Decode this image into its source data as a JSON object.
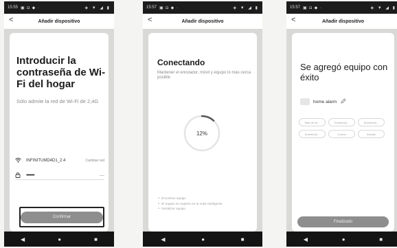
{
  "screens": [
    {
      "status": {
        "time": "15:55",
        "notif": "▣ ◘ ◆ ·",
        "right": "◈ ▼ ◢ ▮"
      },
      "appbar": {
        "back": "<",
        "title": "Añadir dispositivo"
      },
      "title": "Introducir la contraseña de Wi-Fi del hogar",
      "subtitle": "Sólo admite la red de Wi-Fi de 2,4G",
      "wifi": {
        "ssid": "INFINITUMD4D1_2.4",
        "change_label": "Cambiar red"
      },
      "password": {
        "value": "••••••••",
        "eye": "—"
      },
      "confirm_label": "Confirmar",
      "nav": {
        "back": "◀",
        "home": "●",
        "recents": "■"
      }
    },
    {
      "status": {
        "time": "15:57",
        "notif": "▣ ◘ ◆ ·",
        "right": "◈ ▼ ◢ ▮"
      },
      "appbar": {
        "back": "<",
        "title": "Añadir dispositivo"
      },
      "title": "Conectando",
      "subtitle": "Mantener el enrutador, móvil y equipo lo más cerca posible",
      "progress": {
        "percent": 12,
        "label": "12%"
      },
      "steps": [
        "Encontrar equipo",
        "El equipo se registra en la nube inteligente",
        "Inicializar equipo"
      ],
      "nav": {
        "back": "◀",
        "home": "●",
        "recents": "■"
      }
    },
    {
      "status": {
        "time": "15:57",
        "notif": "▣ ◘ ◆ ·",
        "right": "◈ ▼ ◢ ▮"
      },
      "appbar": {
        "back": "<",
        "title": "Añadir dispositivo"
      },
      "title": "Se agregó equipo con éxito",
      "device": {
        "name": "home alarm"
      },
      "chips": [
        "Sala de es...",
        "Dormitorio...",
        "Dormitorio...",
        "Dormitorio...",
        "Cocina",
        "Estudio"
      ],
      "done_label": "Finalizado",
      "nav": {
        "back": "◀",
        "home": "●",
        "recents": "■"
      }
    }
  ],
  "colors": {
    "button_gray": "#8e8e8e",
    "status_bar": "#1c1c1c",
    "progress_arc": "#555555"
  }
}
